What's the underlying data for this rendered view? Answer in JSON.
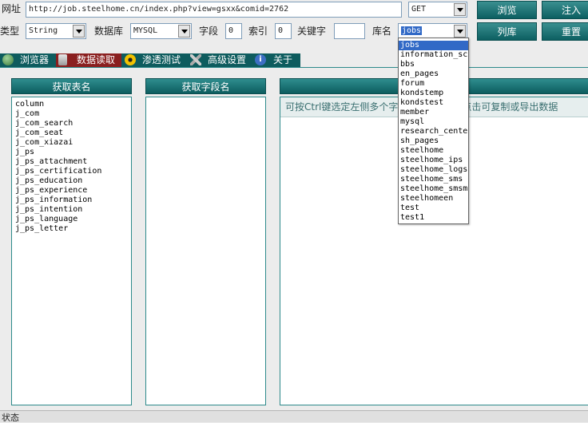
{
  "toolbar": {
    "url_label": "网址",
    "url_value": "http://job.steelhome.cn/index.php?view=gsxx&comid=2762",
    "method": "GET",
    "browse_button": "浏览",
    "inject_button": "注入",
    "type_label": "类型",
    "type_value": "String",
    "db_label": "数据库",
    "db_value": "MYSQL",
    "field_label": "字段",
    "field_value": "0",
    "index_label": "索引",
    "index_value": "0",
    "keyword_label": "关键字",
    "keyword_value": "",
    "dbname_label": "库名",
    "dbname_value": "jobs",
    "list_db_button": "列库",
    "reset_button": "重置"
  },
  "tabs": [
    {
      "label": "浏览器",
      "icon": "globe-icon"
    },
    {
      "label": "数据读取",
      "icon": "database-icon"
    },
    {
      "label": "渗透测试",
      "icon": "radiation-icon"
    },
    {
      "label": "高级设置",
      "icon": "tools-icon"
    },
    {
      "label": "关于",
      "icon": "info-icon"
    }
  ],
  "panels": {
    "tables_title": "获取表名",
    "fields_title": "获取字段名",
    "data_hint": "可按Ctrl键选定左侧多个字段后，右键点击可复制或导出数据",
    "data_hint_visible_left": "可按Ctrl键选定左侧多个字",
    "data_hint_visible_right": "点击可复制或导出数据"
  },
  "tables": [
    "column",
    "j_com",
    "j_com_search",
    "j_com_seat",
    "j_com_xiazai",
    "j_ps",
    "j_ps_attachment",
    "j_ps_certification",
    "j_ps_education",
    "j_ps_experience",
    "j_ps_information",
    "j_ps_intention",
    "j_ps_language",
    "j_ps_letter"
  ],
  "db_options": [
    "jobs",
    "information_sc",
    "bbs",
    "en_pages",
    "forum",
    "kondstemp",
    "kondstest",
    "member",
    "mysql",
    "research_cente",
    "sh_pages",
    "steelhome",
    "steelhome_ips",
    "steelhome_logs",
    "steelhome_sms",
    "steelhome_smsm",
    "steelhomeen",
    "test",
    "test1"
  ],
  "status": {
    "label": "状态"
  },
  "colors": {
    "teal": "#0e5c5e",
    "active_tab": "#8a1f1f",
    "selection": "#3169c6"
  }
}
